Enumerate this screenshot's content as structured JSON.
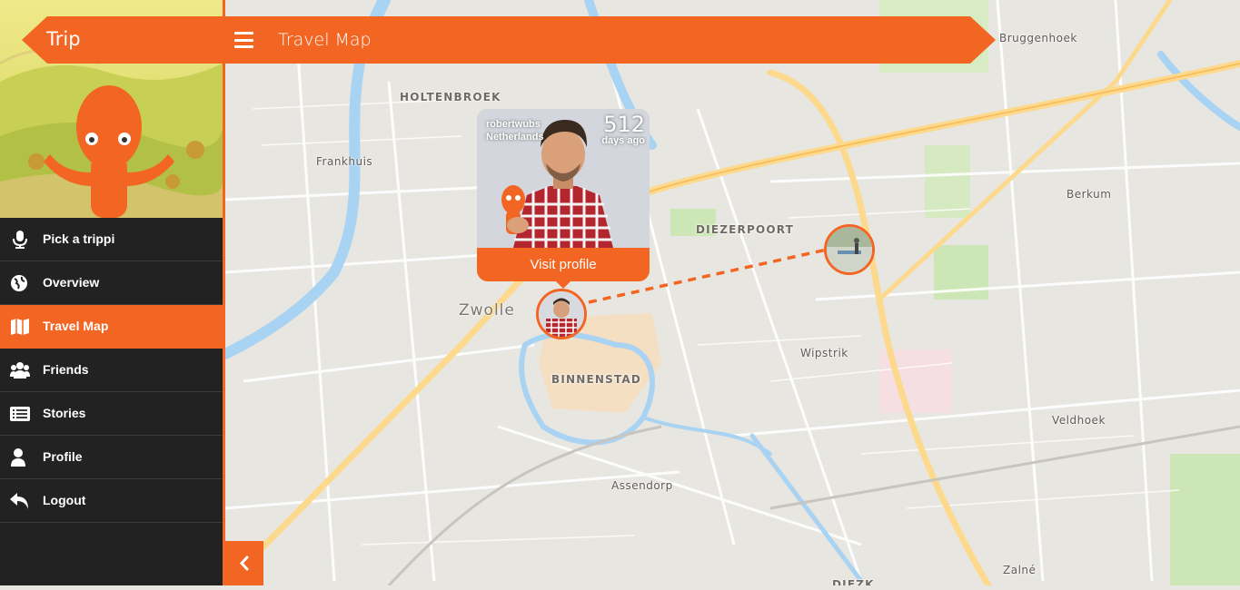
{
  "app": {
    "title": "Trip"
  },
  "header": {
    "title": "Travel Map",
    "menu_icon": "hamburger-icon"
  },
  "sidebar": {
    "items": [
      {
        "label": "Pick a trippi",
        "icon": "microphone-icon",
        "active": false
      },
      {
        "label": "Overview",
        "icon": "globe-icon",
        "active": false
      },
      {
        "label": "Travel Map",
        "icon": "map-icon",
        "active": true
      },
      {
        "label": "Friends",
        "icon": "users-icon",
        "active": false
      },
      {
        "label": "Stories",
        "icon": "list-icon",
        "active": false
      },
      {
        "label": "Profile",
        "icon": "user-icon",
        "active": false
      },
      {
        "label": "Logout",
        "icon": "reply-icon",
        "active": false
      }
    ]
  },
  "popup": {
    "username": "robertwubs",
    "country": "Netherlands",
    "days": "512",
    "days_unit": "days ago",
    "button": "Visit profile"
  },
  "map": {
    "labels": {
      "holtenbroek": "HOLTENBROEK",
      "frankhuis": "Frankhuis",
      "zwolle": "Zwolle",
      "diezerpoort": "DIEZERPOORT",
      "binnenstad": "BINNENSTAD",
      "wipstrik": "Wipstrik",
      "assendorp": "Assendorp",
      "berkum": "Berkum",
      "bruggenhoek": "Bruggenhoek",
      "veldhoek": "Veldhoek",
      "zalne": "Zalné",
      "diezk": "DIEZK"
    }
  },
  "colors": {
    "accent": "#f26522",
    "sidebar_bg": "#222222",
    "map_bg": "#e8e6e1",
    "water": "#a9d3f2",
    "road_major": "#fcd98c"
  },
  "collapse_icon": "chevron-left-icon"
}
